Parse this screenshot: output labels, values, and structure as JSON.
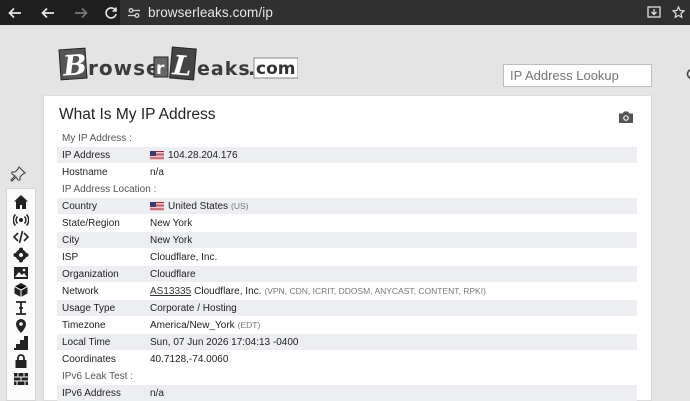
{
  "browser": {
    "url": "browserleaks.com/ip"
  },
  "site": {
    "logo_text": "BrowserLeaks.com",
    "search_placeholder": "IP Address Lookup"
  },
  "sidebar": {
    "items": [
      "pin-icon",
      "home-icon",
      "radio-icon",
      "code-icon",
      "flower-icon",
      "image-icon",
      "cube-icon",
      "text-cursor-icon",
      "location-icon",
      "stairs-icon",
      "lock-icon",
      "wall-icon"
    ]
  },
  "main": {
    "title": "What Is My IP Address",
    "sections": [
      {
        "title": "My IP Address :",
        "rows": [
          {
            "key": "IP Address",
            "value": "104.28.204.176",
            "flag": true
          },
          {
            "key": "Hostname",
            "value": "n/a"
          }
        ]
      },
      {
        "title": "IP Address Location :",
        "rows": [
          {
            "key": "Country",
            "value": "United States",
            "extra": "(US)",
            "flag": true
          },
          {
            "key": "State/Region",
            "value": "New York"
          },
          {
            "key": "City",
            "value": "New York"
          },
          {
            "key": "ISP",
            "value": "Cloudflare, Inc."
          },
          {
            "key": "Organization",
            "value": "Cloudflare"
          },
          {
            "key": "Network",
            "link": "AS13335",
            "value": "Cloudflare, Inc.",
            "extra": "(VPN, CDN, ICRIT, DDOSM, ANYCAST, CONTENT, RPKI)"
          },
          {
            "key": "Usage Type",
            "value": "Corporate / Hosting"
          },
          {
            "key": "Timezone",
            "value": "America/New_York",
            "extra": "(EDT)"
          },
          {
            "key": "Local Time",
            "value": "Sun, 07 Jun 2026 17:04:13 -0400"
          },
          {
            "key": "Coordinates",
            "value": "40.7128,-74.0060"
          }
        ]
      },
      {
        "title": "IPv6 Leak Test :",
        "rows": [
          {
            "key": "IPv6 Address",
            "value": "n/a"
          }
        ]
      }
    ]
  }
}
